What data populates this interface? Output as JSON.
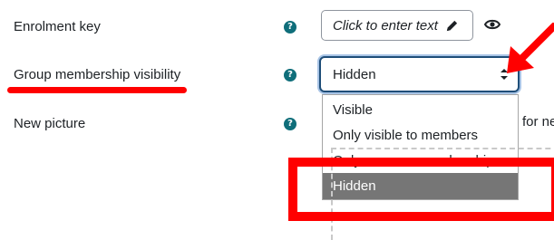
{
  "fields": {
    "enrolment_key": {
      "label": "Enrolment key",
      "value": "Click to enter text"
    },
    "group_visibility": {
      "label": "Group membership visibility",
      "selected": "Hidden",
      "options": [
        "Visible",
        "Only visible to members",
        "Only see own membership",
        "Hidden"
      ]
    },
    "new_picture": {
      "label": "New picture",
      "file_text": "for ne"
    }
  },
  "help_icon_glyph": "?",
  "colors": {
    "annotation_red": "#ff0000",
    "help_icon": "#0f6e7a",
    "selected_option_bg": "#767676",
    "select_border": "#1f4e79"
  }
}
